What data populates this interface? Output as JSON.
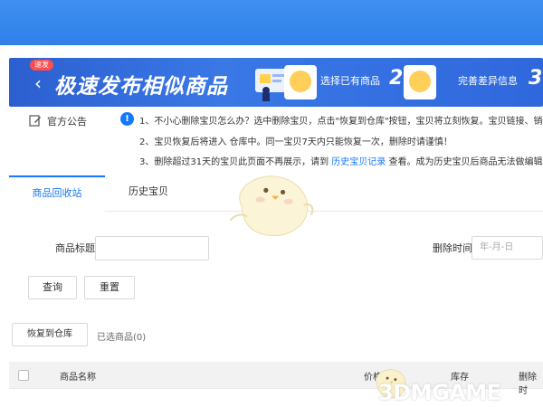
{
  "banner": {
    "badge": "速发",
    "title": "极速发布相似商品",
    "step1_label": "选择已有商品",
    "step2_number": "2",
    "step2_label": "完善差异信息",
    "step3_number": "3"
  },
  "notice": {
    "title": "官方公告",
    "info_mark": "!",
    "lines": [
      "1、不小心删除宝贝怎么办？选中删除宝贝，点击\"恢复到仓库\"按钮，宝贝将立刻恢复。宝贝链接、销量",
      "2、宝贝恢复后将进入 仓库中。同一宝贝7天内只能恢复一次，删除时请谨慎！",
      "3、删除超过31天的宝贝此页面不再展示，请到"
    ],
    "line3_link": "历史宝贝记录",
    "line3_suffix": "查看。成为历史宝贝后商品无法做编辑"
  },
  "tabs": [
    {
      "label": "商品回收站",
      "active": true
    },
    {
      "label": "历史宝贝",
      "active": false
    }
  ],
  "filters": {
    "title_label": "商品标题",
    "title_value": "",
    "delete_time_label": "删除时间",
    "date_placeholder": "年-月-日"
  },
  "buttons": {
    "query": "查询",
    "reset": "重置",
    "restore": "恢复到仓库"
  },
  "selected_text": "已选商品(0)",
  "table": {
    "columns": [
      "商品名称",
      "价格",
      "库存",
      "删除时"
    ]
  },
  "watermark": "3DMGAME",
  "colors": {
    "accent": "#1677ff",
    "topbar": "#2f80ea",
    "banner": "#2f68dc"
  }
}
